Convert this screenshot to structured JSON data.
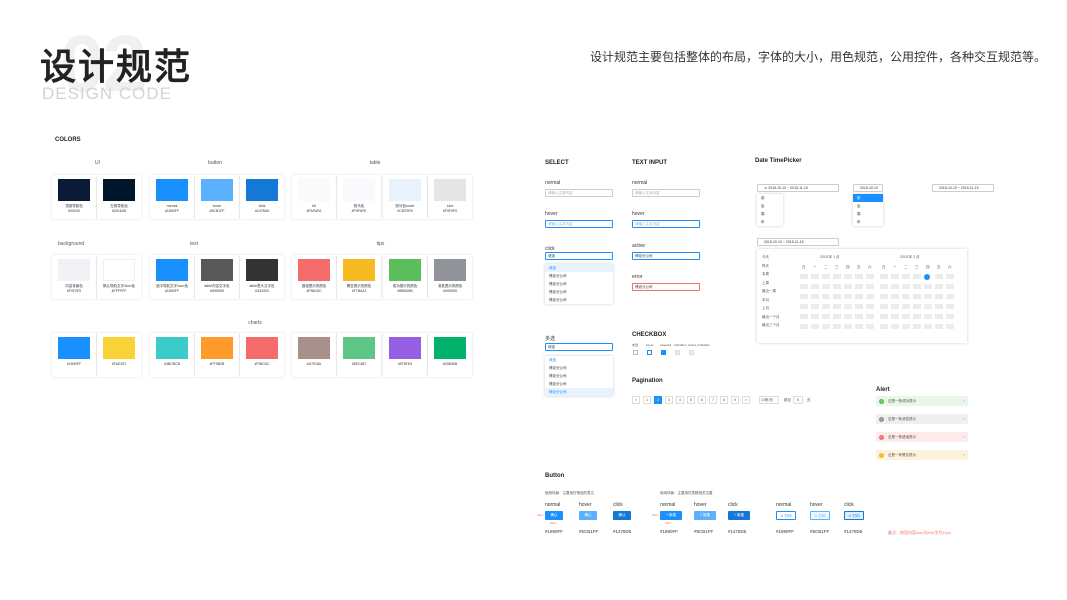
{
  "header": {
    "title": "设计规范",
    "number": "02",
    "subtitle": "DESIGN CODE",
    "description": "设计规范主要包括整体的布局，字体的大小，用色规范，公用控件，各种交互规范等。"
  },
  "colors": {
    "title": "COLORS",
    "groups": {
      "ui": "UI",
      "button": "button",
      "table": "table",
      "background": "background",
      "text": "text",
      "tips": "tips",
      "charts": "charts"
    },
    "row1": [
      {
        "name": "顶部导航色",
        "hex": "#00040",
        "color": "#0b1a36"
      },
      {
        "name": "左侧导航色",
        "hex": "#00162B",
        "color": "#00162b"
      },
      {
        "name": "normal",
        "hex": "#1890FF",
        "color": "#1890ff"
      },
      {
        "name": "hover",
        "hex": "#5CB1FF",
        "color": "#5cb1ff"
      },
      {
        "name": "click",
        "hex": "#1478D6",
        "color": "#1478d6"
      },
      {
        "name": "tilt",
        "hex": "#FAFAFA",
        "color": "#fafafa"
      },
      {
        "name": "斑马色",
        "hex": "#F9FAFE",
        "color": "#f9fafe"
      },
      {
        "name": "斑马色hover",
        "hex": "#CEE3F6",
        "color": "#e8f2fd"
      },
      {
        "name": "Line",
        "hex": "#F0F0F0",
        "color": "#e6e6e6"
      }
    ],
    "row2": [
      {
        "name": "内容背景色",
        "hex": "#F0F2F5",
        "color": "#f0f2f5"
      },
      {
        "name": "默认导航文字/icon色",
        "hex": "#FFFFFF",
        "color": "#ffffff"
      },
      {
        "name": "选中导航文字/icon色",
        "hex": "#1890FF",
        "color": "#1890ff"
      },
      {
        "name": "table内容文字色",
        "hex": "#595959",
        "color": "#595959"
      },
      {
        "name": "table表头文字色",
        "hex": "#333333",
        "color": "#333333"
      },
      {
        "name": "错误提示的颜色",
        "hex": "#F56C6C",
        "color": "#f56c6c"
      },
      {
        "name": "警告提示的颜色",
        "hex": "#F7BA22",
        "color": "#f7ba22"
      },
      {
        "name": "成功提示的颜色",
        "hex": "#5BBD5B",
        "color": "#5bbd5b"
      },
      {
        "name": "消息提示的颜色",
        "hex": "#909399",
        "color": "#909399"
      }
    ],
    "row3": [
      {
        "hex": "#1890FF",
        "color": "#1890ff"
      },
      {
        "hex": "#FAD337",
        "color": "#fad337"
      },
      {
        "hex": "#3BCBCB",
        "color": "#3bcbcb"
      },
      {
        "hex": "#FF9B2B",
        "color": "#ff9b2b"
      },
      {
        "hex": "#F56C6C",
        "color": "#f56c6c"
      },
      {
        "hex": "#A7918A",
        "color": "#a7918a"
      },
      {
        "hex": "#5EC687",
        "color": "#5ec687"
      },
      {
        "hex": "#975FE4",
        "color": "#975fe4"
      },
      {
        "hex": "#00B36B",
        "color": "#00b36b"
      }
    ]
  },
  "select": {
    "title": "SELECT",
    "normal": "normal",
    "normal_ph": "请输入文本内容",
    "hover": "hover",
    "hover_ph": "请输入文本内容",
    "click": "click",
    "click_val": "请选",
    "options": [
      "请选",
      "博克分公司",
      "博克分公司",
      "博克分公司",
      "博克分公司"
    ],
    "multi": "多选",
    "multi_val": "请选",
    "multi_options": [
      "请选",
      "博克分公司",
      "博克分公司",
      "博克分公司",
      "博克分公司"
    ]
  },
  "text_input": {
    "title": "TEXT INPUT",
    "normal": "normal",
    "normal_ph": "请输入文本内容",
    "hover": "hover",
    "hover_ph": "请输入文本内容",
    "active": "active",
    "active_val": "博克分公司",
    "error": "error",
    "error_val": "博克分公司"
  },
  "checkbox": {
    "title": "CHECKBOX",
    "states": [
      "未选",
      "hover",
      "selected",
      "forbidden",
      "select_forbidden"
    ]
  },
  "pagination": {
    "title": "Pagination",
    "pages": [
      "<",
      "1",
      "2",
      "3",
      "4",
      "5",
      "6",
      "7",
      "8",
      "9",
      ">"
    ],
    "size": "10条/页",
    "goto": "跳至",
    "page_unit": "页",
    "goto_val": "5"
  },
  "datepicker": {
    "title": "Date TimePicker",
    "range": "2015-10-10 ~ 2015-11-15",
    "single": "2015-10-10",
    "range2": "2015-10-10 ~ 2015-11-15",
    "range3": "2015-10-10 ~ 2015-11-15",
    "quick": [
      "今天",
      "昨天",
      "本周",
      "上周",
      "最近一周",
      "本月",
      "上月",
      "最近一个月",
      "最近三个月"
    ],
    "left_month": "2018 年 1 月",
    "right_month": "2018 年 2 月",
    "weekdays": [
      "日",
      "一",
      "二",
      "三",
      "四",
      "五",
      "六"
    ],
    "small_list": [
      "前",
      "后",
      "周",
      "年"
    ],
    "small_list2": [
      "前",
      "后",
      "周",
      "年"
    ]
  },
  "alert": {
    "title": "Alert",
    "items": [
      {
        "text": "这是一条成功提示",
        "bg": "#e8f7e8",
        "ic": "#5bbd5b",
        "icon": "✓"
      },
      {
        "text": "这是一条消息提示",
        "bg": "#efefef",
        "ic": "#909399",
        "icon": "i"
      },
      {
        "text": "这是一条错误提示",
        "bg": "#fdeaea",
        "ic": "#f56c6c",
        "icon": "×"
      },
      {
        "text": "这是一条警告提示",
        "bg": "#fdf3dd",
        "ic": "#f7ba22",
        "icon": "!"
      }
    ]
  },
  "button": {
    "title": "Button",
    "note1": "使用场景：主要用在筛选的表达",
    "note2": "使用场景：主要用在表格相关位置",
    "states": [
      "normal",
      "hover",
      "click"
    ],
    "hex": [
      "#1890FF",
      "#5CB1FF",
      "#1478D5"
    ],
    "labels": [
      "确认",
      "确认",
      "确认",
      "+ 新建",
      "+ 新建",
      "+ 新建",
      "⊙ 打印",
      "⊙ 打印",
      "⊙ 打印"
    ],
    "remark": "备注：按钮内容icon为6*6/字号11px",
    "dim1": "33px",
    "dim2": "60px"
  }
}
